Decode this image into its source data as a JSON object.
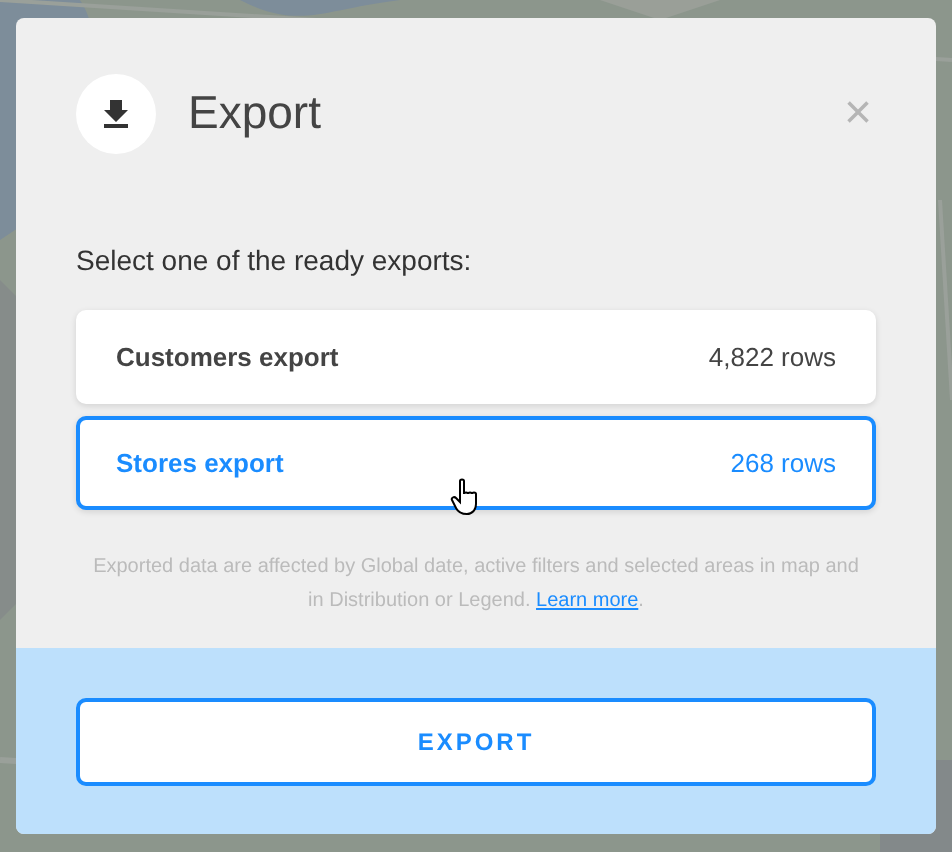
{
  "dialog": {
    "title": "Export",
    "close": "×",
    "prompt": "Select one of the ready exports:",
    "exports": [
      {
        "name": "Customers export",
        "rows": "4,822 rows",
        "selected": false
      },
      {
        "name": "Stores export",
        "rows": "268 rows",
        "selected": true
      }
    ],
    "note": {
      "text": "Exported data are affected by Global date, active filters and selected areas in map and in Distribution or Legend.",
      "link": "Learn more",
      "end": "."
    },
    "button": "EXPORT"
  }
}
